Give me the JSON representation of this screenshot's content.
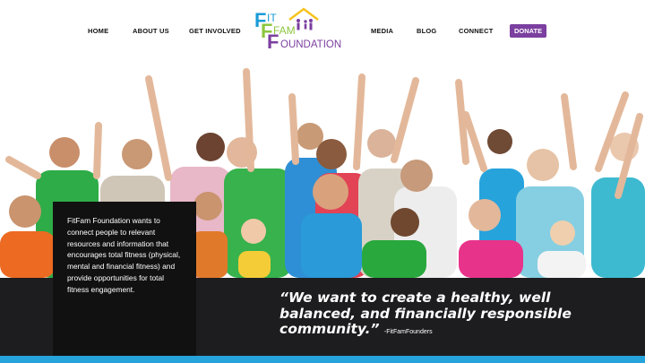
{
  "nav": {
    "left": [
      "HOME",
      "ABOUT US",
      "GET INVOLVED"
    ],
    "right": [
      "MEDIA",
      "BLOG",
      "CONNECT"
    ],
    "donate": "DONATE"
  },
  "logo": {
    "line1": "IT",
    "line2": "FAM",
    "line3": "OUNDATION",
    "initial": "F"
  },
  "info": {
    "text": "FitFam Foundation wants to connect people to relevant resources and information that encourages total fitness (physical, mental and financial fitness) and provide opportunities for total fitness engagement."
  },
  "quote": {
    "text": "“We want to create a healthy, well balanced, and financially responsible community.”",
    "attribution": "-FitFamFounders"
  },
  "colors": {
    "accent_purple": "#7b3fa0",
    "band": "#1d1d1f",
    "footer_blue": "#27a3dc",
    "logo_green": "#8dc63f",
    "logo_blue": "#1a9bd7",
    "logo_yellow": "#f7c21b"
  }
}
